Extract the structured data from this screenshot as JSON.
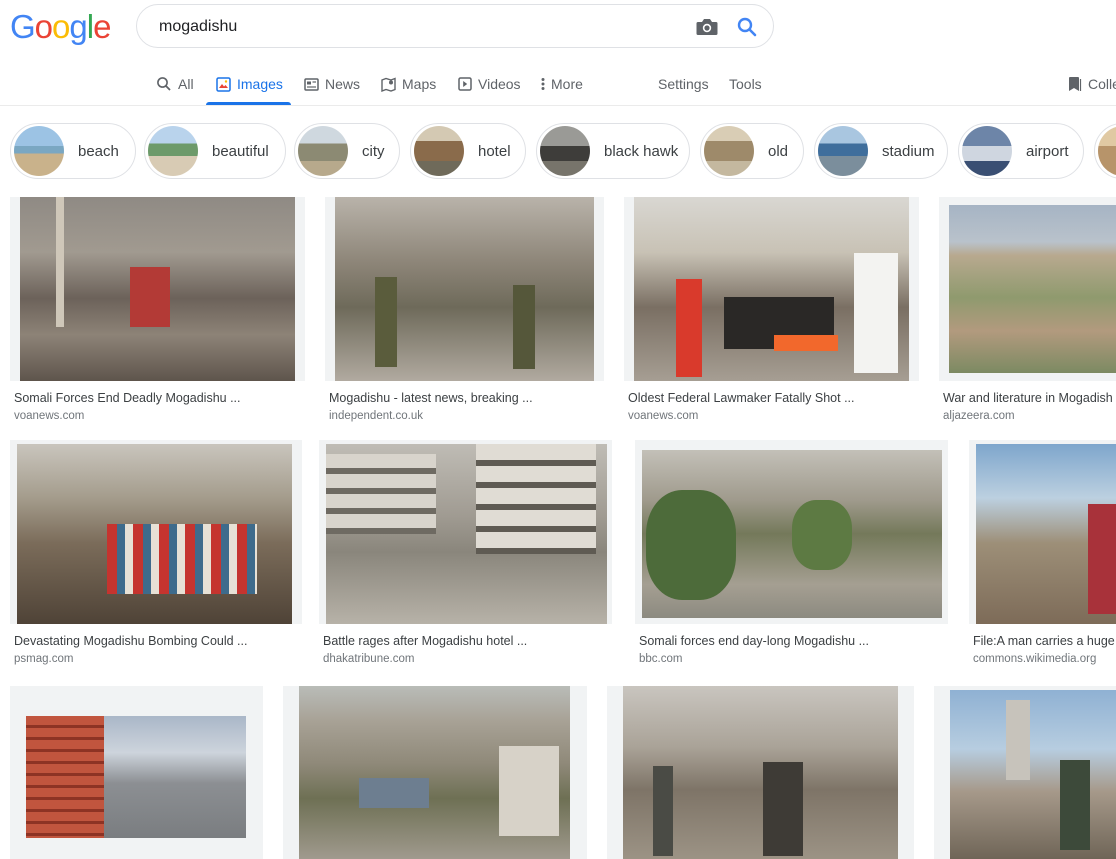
{
  "logo": {
    "letters": [
      "G",
      "o",
      "o",
      "g",
      "l",
      "e"
    ],
    "colors": [
      "#4285f4",
      "#ea4335",
      "#fbbc05",
      "#4285f4",
      "#34a853",
      "#ea4335"
    ]
  },
  "search": {
    "query": "mogadishu",
    "camera_icon": "camera-icon",
    "search_icon": "search-icon"
  },
  "tabs": [
    {
      "label": "All",
      "icon": "search-icon"
    },
    {
      "label": "Images",
      "icon": "image-icon",
      "active": true
    },
    {
      "label": "News",
      "icon": "news-icon"
    },
    {
      "label": "Maps",
      "icon": "map-icon"
    },
    {
      "label": "Videos",
      "icon": "video-icon"
    },
    {
      "label": "More",
      "icon": "more-vertical-icon"
    },
    {
      "label": "Settings"
    },
    {
      "label": "Tools"
    },
    {
      "label": "Colle",
      "icon": "bookmark-icon"
    }
  ],
  "chips": [
    {
      "label": "beach"
    },
    {
      "label": "beautiful"
    },
    {
      "label": "city"
    },
    {
      "label": "hotel"
    },
    {
      "label": "black hawk"
    },
    {
      "label": "old"
    },
    {
      "label": "stadium"
    },
    {
      "label": "airport"
    }
  ],
  "results": [
    {
      "title": "Somali Forces End Deadly Mogadishu ...",
      "source": "voanews.com"
    },
    {
      "title": "Mogadishu - latest news, breaking ...",
      "source": "independent.co.uk"
    },
    {
      "title": "Oldest Federal Lawmaker Fatally Shot ...",
      "source": "voanews.com"
    },
    {
      "title": "War and literature in Mogadish",
      "source": "aljazeera.com"
    },
    {
      "title": "Devastating Mogadishu Bombing Could ...",
      "source": "psmag.com"
    },
    {
      "title": "Battle rages after Mogadishu hotel ...",
      "source": "dhakatribune.com"
    },
    {
      "title": "Somali forces end day-long Mogadishu ...",
      "source": "bbc.com"
    },
    {
      "title": "File:A man carries a huge",
      "source": "commons.wikimedia.org"
    },
    {
      "title": "",
      "source": ""
    },
    {
      "title": "",
      "source": ""
    },
    {
      "title": "",
      "source": ""
    },
    {
      "title": "",
      "source": ""
    }
  ],
  "colors": {
    "accent": "#1a73e8",
    "tab_text": "#5f6368",
    "border": "#dfe1e5"
  }
}
